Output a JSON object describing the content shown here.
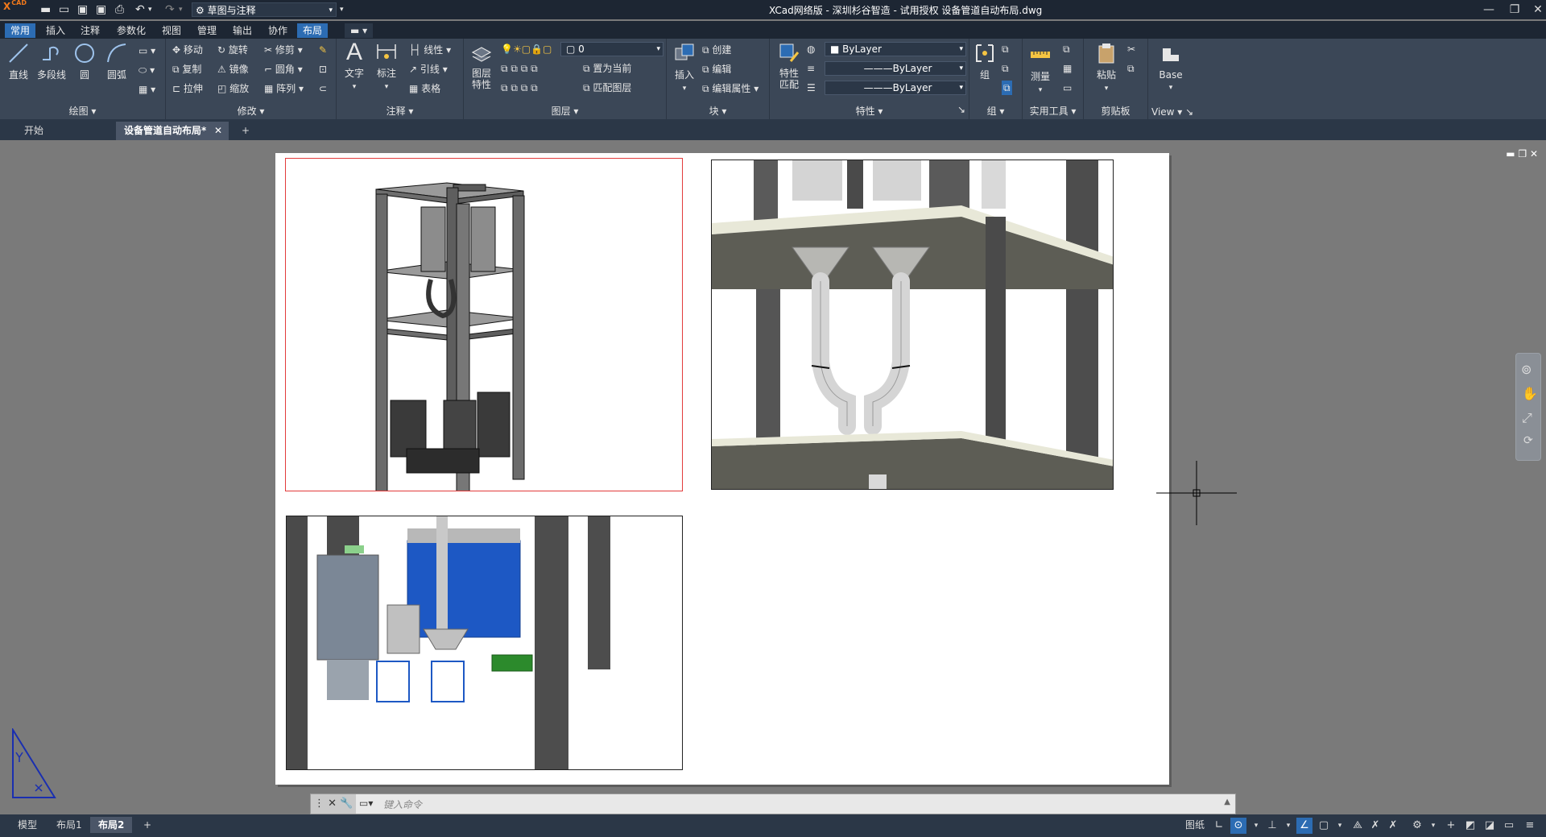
{
  "app": {
    "logo": "X",
    "logo_sup": "CAD",
    "window_title": "XCad网络版 - 深圳杉谷智造 - 试用授权    设备管道自动布局.dwg",
    "workspace": "草图与注释"
  },
  "ribbon_tabs": [
    "常用",
    "插入",
    "注释",
    "参数化",
    "视图",
    "管理",
    "输出",
    "协作",
    "布局"
  ],
  "ribbon": {
    "draw": {
      "label": "绘图",
      "line": "直线",
      "polyline": "多段线",
      "circle": "圆",
      "arc": "圆弧"
    },
    "modify": {
      "label": "修改",
      "move": "移动",
      "rotate": "旋转",
      "trim": "修剪",
      "copy": "复制",
      "mirror": "镜像",
      "fillet": "圆角",
      "stretch": "拉伸",
      "scale": "缩放",
      "array": "阵列"
    },
    "annotation": {
      "label": "注释",
      "text": "文字",
      "dimension": "标注",
      "linear": "线性",
      "leader": "引线",
      "table": "表格"
    },
    "layers": {
      "label": "图层",
      "layer_props": "图层\n特性",
      "layer_value": "0",
      "set_current": "置为当前",
      "match_layer": "匹配图层"
    },
    "block": {
      "label": "块",
      "insert": "插入",
      "create": "创建",
      "edit": "编辑",
      "edit_attr": "编辑属性"
    },
    "properties": {
      "label": "特性",
      "match": "特性\n匹配",
      "color": "ByLayer",
      "linetype": "ByLayer",
      "lineweight": "ByLayer"
    },
    "groups": {
      "label": "组",
      "group": "组"
    },
    "utilities": {
      "label": "实用工具",
      "measure": "测量"
    },
    "clipboard": {
      "label": "剪贴板",
      "paste": "粘贴"
    },
    "view": {
      "label": "View",
      "base": "Base"
    }
  },
  "doc_tabs": [
    "开始",
    "设备管道自动布局*"
  ],
  "command_placeholder": "键入命令",
  "layout_tabs": [
    "模型",
    "布局1",
    "布局2"
  ],
  "status": {
    "paper": "图纸"
  },
  "colors": {
    "accent": "#2c6cb3",
    "viewport_active_border": "#e23b3b",
    "ribbon_bg": "#3b4757",
    "title_bg": "#1d2633"
  }
}
